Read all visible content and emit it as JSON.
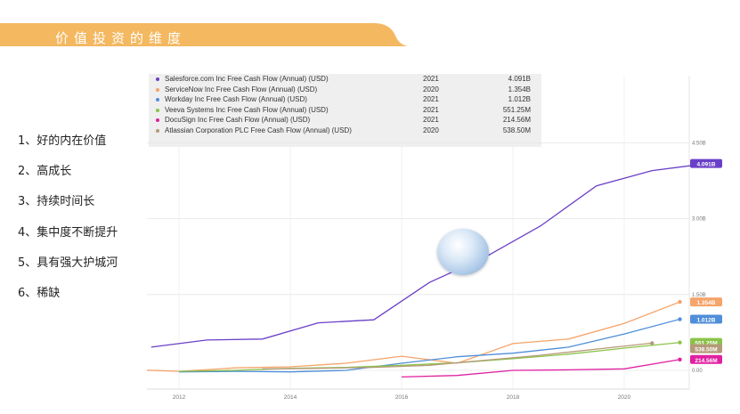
{
  "slide": {
    "title": "价值投资的维度",
    "accent_color": "#F4B860",
    "points": [
      "1、好的内在价值",
      "2、高成长",
      "3、持续时间长",
      "4、集中度不断提升",
      "5、具有强大护城河",
      "6、稀缺"
    ]
  },
  "chart_data": {
    "type": "line",
    "x_ticks": [
      "2012",
      "2014",
      "2016",
      "2018",
      "2020"
    ],
    "y_ticks": [
      "0.00",
      "1.50B",
      "3.00B",
      "4.50B"
    ],
    "ylim": [
      0,
      4.5
    ],
    "legend": [
      {
        "name": "Salesforce.com Inc Free Cash Flow (Annual) (USD)",
        "year": "2021",
        "value": "4.091B",
        "color": "#6A3FC8"
      },
      {
        "name": "ServiceNow Inc Free Cash Flow (Annual) (USD)",
        "year": "2020",
        "value": "1.354B",
        "color": "#F5A46A"
      },
      {
        "name": "Workday Inc Free Cash Flow (Annual) (USD)",
        "year": "2021",
        "value": "1.012B",
        "color": "#4F8ED9"
      },
      {
        "name": "Veeva Systems Inc Free Cash Flow (Annual) (USD)",
        "year": "2021",
        "value": "551.25M",
        "color": "#8BC34A"
      },
      {
        "name": "DocuSign Inc Free Cash Flow (Annual) (USD)",
        "year": "2021",
        "value": "214.56M",
        "color": "#E020A0"
      },
      {
        "name": "Atlassian Corporation PLC Free Cash Flow (Annual) (USD)",
        "year": "2020",
        "value": "538.50M",
        "color": "#B49A78"
      }
    ],
    "series": [
      {
        "name": "Salesforce.com",
        "color": "#6A3FC8",
        "label": "4.091B",
        "x": [
          2011.5,
          2012.5,
          2013.5,
          2014.5,
          2015.5,
          2016.5,
          2017.5,
          2018.5,
          2019.5,
          2020.5,
          2021.5
        ],
        "values": [
          0.46,
          0.6,
          0.62,
          0.94,
          1.0,
          1.74,
          2.24,
          2.86,
          3.65,
          3.95,
          4.091
        ]
      },
      {
        "name": "ServiceNow",
        "color": "#F5A46A",
        "label": "1.354B",
        "x": [
          2011,
          2012,
          2013,
          2014,
          2015,
          2016,
          2017,
          2018,
          2019,
          2020,
          2021
        ],
        "values": [
          0.02,
          -0.02,
          0.05,
          0.07,
          0.14,
          0.28,
          0.14,
          0.53,
          0.62,
          0.93,
          1.354
        ]
      },
      {
        "name": "Workday",
        "color": "#4F8ED9",
        "label": "1.012B",
        "x": [
          2012,
          2013,
          2014,
          2015,
          2016,
          2017,
          2018,
          2019,
          2020,
          2021
        ],
        "values": [
          -0.03,
          -0.02,
          -0.03,
          0.0,
          0.14,
          0.27,
          0.34,
          0.46,
          0.72,
          1.012
        ]
      },
      {
        "name": "Veeva Systems",
        "color": "#8BC34A",
        "label": "551.25M",
        "x": [
          2012,
          2013,
          2014,
          2015,
          2016,
          2017,
          2018,
          2019,
          2020,
          2021
        ],
        "values": [
          -0.02,
          0.0,
          0.04,
          0.06,
          0.1,
          0.15,
          0.23,
          0.32,
          0.44,
          0.5513
        ]
      },
      {
        "name": "DocuSign",
        "color": "#E020A0",
        "label": "214.56M",
        "x": [
          2016,
          2017,
          2018,
          2019,
          2020,
          2021
        ],
        "values": [
          -0.13,
          -0.1,
          0.0,
          0.01,
          0.03,
          0.2146
        ]
      },
      {
        "name": "Atlassian",
        "color": "#B49A78",
        "label": "538.50M",
        "x": [
          2013.5,
          2014.5,
          2015.5,
          2016.5,
          2017.5,
          2018.5,
          2019.5,
          2020.5
        ],
        "values": [
          0.03,
          0.04,
          0.06,
          0.1,
          0.2,
          0.3,
          0.42,
          0.5385
        ]
      }
    ]
  }
}
